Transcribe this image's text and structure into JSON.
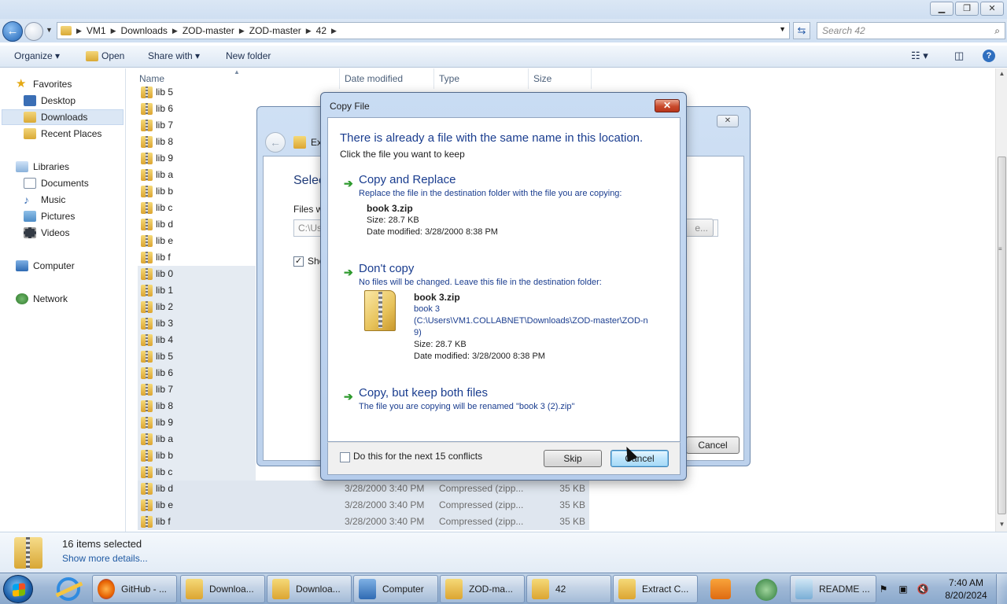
{
  "window": {
    "breadcrumb": [
      "VM1",
      "Downloads",
      "ZOD-master",
      "ZOD-master",
      "42"
    ],
    "search_placeholder": "Search 42",
    "controls": [
      "minimize",
      "restore",
      "close"
    ]
  },
  "toolbar": {
    "organize": "Organize ▾",
    "open": "Open",
    "share_with": "Share with ▾",
    "new_folder": "New folder"
  },
  "navpane": {
    "favorites": "Favorites",
    "desktop": "Desktop",
    "downloads": "Downloads",
    "recent_places": "Recent Places",
    "libraries": "Libraries",
    "documents": "Documents",
    "music": "Music",
    "pictures": "Pictures",
    "videos": "Videos",
    "computer": "Computer",
    "network": "Network"
  },
  "columns": {
    "name": "Name",
    "date_modified": "Date modified",
    "type": "Type",
    "size": "Size"
  },
  "files": [
    {
      "name": "lib 5",
      "date": "",
      "type": "",
      "size": ""
    },
    {
      "name": "lib 6",
      "date": "",
      "type": "",
      "size": ""
    },
    {
      "name": "lib 7",
      "date": "",
      "type": "",
      "size": ""
    },
    {
      "name": "lib 8",
      "date": "",
      "type": "",
      "size": ""
    },
    {
      "name": "lib 9",
      "date": "",
      "type": "",
      "size": ""
    },
    {
      "name": "lib a",
      "date": "",
      "type": "",
      "size": ""
    },
    {
      "name": "lib b",
      "date": "",
      "type": "",
      "size": ""
    },
    {
      "name": "lib c",
      "date": "",
      "type": "",
      "size": ""
    },
    {
      "name": "lib d",
      "date": "",
      "type": "",
      "size": ""
    },
    {
      "name": "lib e",
      "date": "",
      "type": "",
      "size": ""
    },
    {
      "name": "lib f",
      "date": "",
      "type": "",
      "size": ""
    },
    {
      "name": "lib 0",
      "date": "",
      "type": "",
      "size": ""
    },
    {
      "name": "lib 1",
      "date": "",
      "type": "",
      "size": ""
    },
    {
      "name": "lib 2",
      "date": "",
      "type": "",
      "size": ""
    },
    {
      "name": "lib 3",
      "date": "",
      "type": "",
      "size": ""
    },
    {
      "name": "lib 4",
      "date": "",
      "type": "",
      "size": ""
    },
    {
      "name": "lib 5",
      "date": "",
      "type": "",
      "size": ""
    },
    {
      "name": "lib 6",
      "date": "",
      "type": "",
      "size": ""
    },
    {
      "name": "lib 7",
      "date": "",
      "type": "",
      "size": ""
    },
    {
      "name": "lib 8",
      "date": "",
      "type": "",
      "size": ""
    },
    {
      "name": "lib 9",
      "date": "",
      "type": "",
      "size": ""
    },
    {
      "name": "lib a",
      "date": "",
      "type": "",
      "size": ""
    },
    {
      "name": "lib b",
      "date": "",
      "type": "",
      "size": ""
    },
    {
      "name": "lib c",
      "date": "",
      "type": "",
      "size": ""
    },
    {
      "name": "lib d",
      "date": "3/28/2000 3:40 PM",
      "type": "Compressed (zipp...",
      "size": "35 KB"
    },
    {
      "name": "lib e",
      "date": "3/28/2000 3:40 PM",
      "type": "Compressed (zipp...",
      "size": "35 KB"
    },
    {
      "name": "lib f",
      "date": "3/28/2000 3:40 PM",
      "type": "Compressed (zipp...",
      "size": "35 KB"
    }
  ],
  "details": {
    "count": "16 items selected",
    "link": "Show more details..."
  },
  "extract_dialog": {
    "title_partial": "Ext",
    "heading_partial": "Selec",
    "files_label_partial": "Files w",
    "path_partial": "C:\\Us",
    "browse_partial": "e...",
    "show_partial": "Sho",
    "cancel": "Cancel"
  },
  "copy_dialog": {
    "title": "Copy File",
    "heading": "There is already a file with the same name in this location.",
    "subheading": "Click the file you want to keep",
    "replace": {
      "title": "Copy and Replace",
      "desc": "Replace the file in the destination folder with the file you are copying:",
      "file": "book 3.zip",
      "size": "Size: 28.7 KB",
      "date": "Date modified: 3/28/2000 8:38 PM"
    },
    "dont_copy": {
      "title": "Don't copy",
      "desc": "No files will be changed. Leave this file in the destination folder:",
      "file": "book 3.zip",
      "name": "book 3",
      "path_line1": "(C:\\Users\\VM1.COLLABNET\\Downloads\\ZOD-master\\ZOD-n",
      "path_line2": "9)",
      "size": "Size: 28.7 KB",
      "date": "Date modified: 3/28/2000 8:38 PM"
    },
    "keep_both": {
      "title": "Copy, but keep both files",
      "desc": "The file you are copying will be renamed \"book 3 (2).zip\""
    },
    "checkbox": "Do this for the next 15 conflicts",
    "skip": "Skip",
    "cancel": "Cancel"
  },
  "taskbar": {
    "tasks": [
      "GitHub - ...",
      "Downloa...",
      "Downloa...",
      "Computer",
      "ZOD-ma...",
      "42",
      "Extract C...",
      "README ..."
    ],
    "time": "7:40 AM",
    "date": "8/20/2024"
  }
}
